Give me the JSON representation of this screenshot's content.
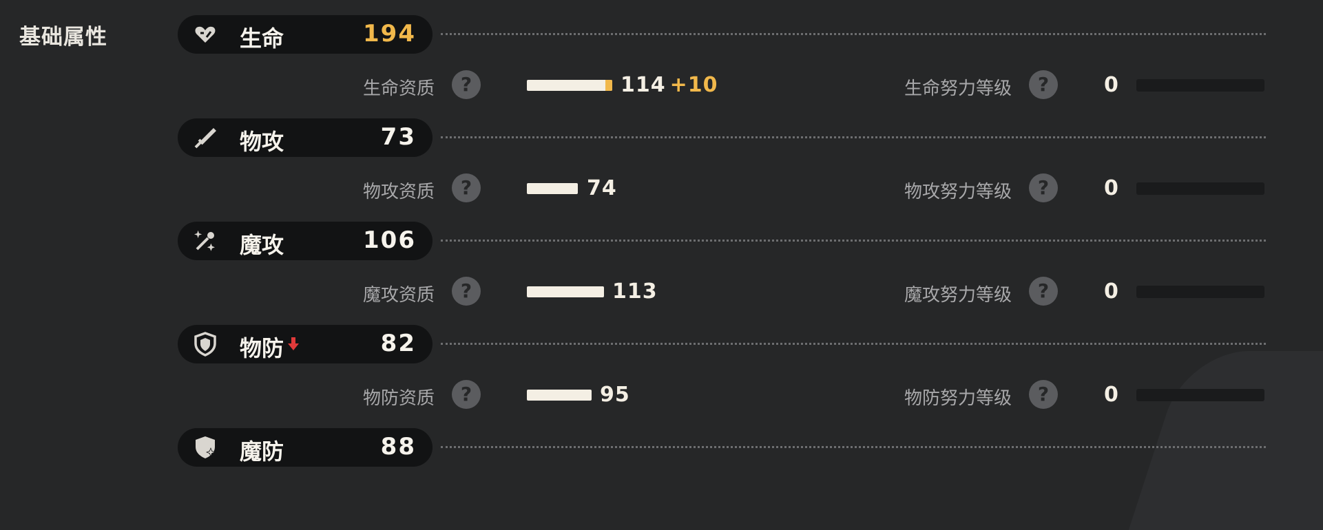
{
  "section_title": "基础属性",
  "colors": {
    "accent_gold": "#f1b84b",
    "down_red": "#e03a3a",
    "bar_fill": "#f4efe4"
  },
  "stats": [
    {
      "icon": "heart-icon",
      "label": "生命",
      "value": "194",
      "value_highlight": true,
      "down": false,
      "aptitude_label": "生命资质",
      "aptitude_value": "114",
      "aptitude_bonus": "+10",
      "effort_label": "生命努力等级",
      "effort_value": "0",
      "effort_level": 0
    },
    {
      "icon": "sword-icon",
      "label": "物攻",
      "value": "73",
      "value_highlight": false,
      "down": false,
      "aptitude_label": "物攻资质",
      "aptitude_value": "74",
      "aptitude_bonus": "",
      "effort_label": "物攻努力等级",
      "effort_value": "0",
      "effort_level": 0
    },
    {
      "icon": "magic-wand-icon",
      "label": "魔攻",
      "value": "106",
      "value_highlight": false,
      "down": false,
      "aptitude_label": "魔攻资质",
      "aptitude_value": "113",
      "aptitude_bonus": "",
      "effort_label": "魔攻努力等级",
      "effort_value": "0",
      "effort_level": 0
    },
    {
      "icon": "shield-icon",
      "label": "物防",
      "value": "82",
      "value_highlight": false,
      "down": true,
      "aptitude_label": "物防资质",
      "aptitude_value": "95",
      "aptitude_bonus": "",
      "effort_label": "物防努力等级",
      "effort_value": "0",
      "effort_level": 0
    },
    {
      "icon": "magic-shield-icon",
      "label": "魔防",
      "value": "88",
      "value_highlight": false,
      "down": false
    }
  ],
  "help_icon_glyph": "?"
}
